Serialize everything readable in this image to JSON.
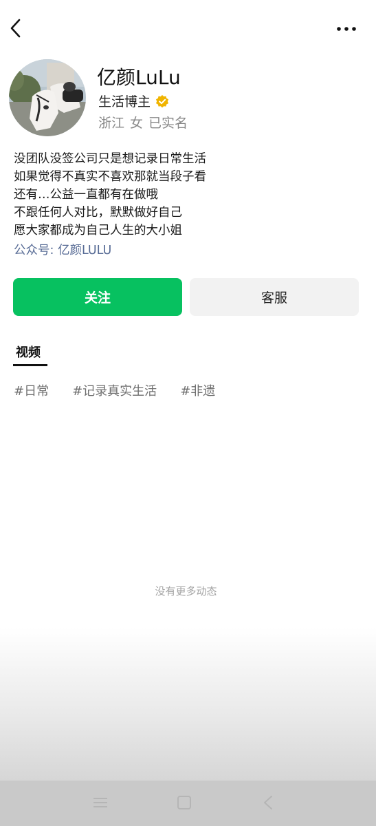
{
  "header": {
    "back_icon": "chevron-left-icon",
    "more_icon": "more-dots-icon"
  },
  "profile": {
    "avatar_icon": "avatar-image",
    "name": "亿颜LuLu",
    "role": "生活博主",
    "verified_icon": "verified-badge-icon",
    "verified_color": "#f0b400",
    "region": "浙江",
    "gender": "女",
    "verification_status": "已实名"
  },
  "bio": {
    "lines": [
      "没团队没签公司只是想记录日常生活",
      "如果觉得不真实不喜欢那就当段子看",
      "还有…公益一直都有在做哦",
      "不跟任何人对比，默默做好自己",
      "愿大家都成为自己人生的大小姐"
    ],
    "official_account": "公众号: 亿颜LULU",
    "link_color": "#576b95"
  },
  "actions": {
    "follow_label": "关注",
    "follow_color": "#07c160",
    "service_label": "客服"
  },
  "tabs": [
    {
      "label": "视频",
      "active": true
    }
  ],
  "tags": [
    "#日常",
    "#记录真实生活",
    "#非遗"
  ],
  "feed": {
    "empty_message": "没有更多动态"
  },
  "system_nav": {
    "menu_icon": "menu-icon",
    "home_icon": "home-square-icon",
    "back_icon": "back-triangle-icon"
  }
}
